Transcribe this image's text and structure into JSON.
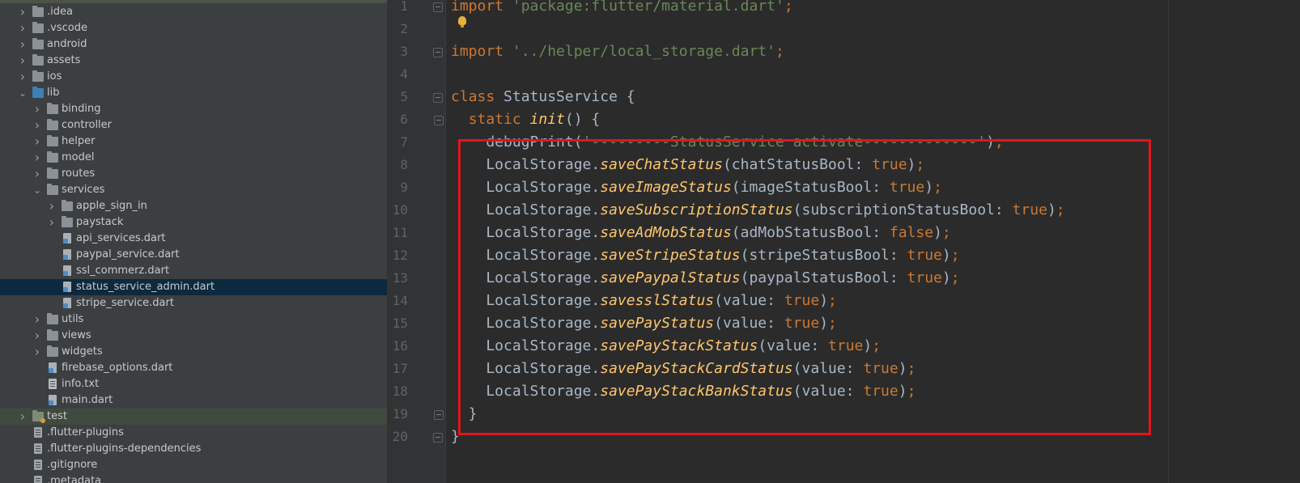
{
  "project_tree": {
    "items": [
      {
        "label": ".idea",
        "type": "folder",
        "expanded": false,
        "indent": 0
      },
      {
        "label": ".vscode",
        "type": "folder",
        "expanded": false,
        "indent": 0
      },
      {
        "label": "android",
        "type": "folder",
        "expanded": false,
        "indent": 0
      },
      {
        "label": "assets",
        "type": "folder",
        "expanded": false,
        "indent": 0
      },
      {
        "label": "ios",
        "type": "folder",
        "expanded": false,
        "indent": 0
      },
      {
        "label": "lib",
        "type": "folder",
        "expanded": true,
        "indent": 0
      },
      {
        "label": "binding",
        "type": "folder",
        "expanded": false,
        "indent": 1
      },
      {
        "label": "controller",
        "type": "folder",
        "expanded": false,
        "indent": 1
      },
      {
        "label": "helper",
        "type": "folder",
        "expanded": false,
        "indent": 1
      },
      {
        "label": "model",
        "type": "folder",
        "expanded": false,
        "indent": 1
      },
      {
        "label": "routes",
        "type": "folder",
        "expanded": false,
        "indent": 1
      },
      {
        "label": "services",
        "type": "folder",
        "expanded": true,
        "indent": 1
      },
      {
        "label": "apple_sign_in",
        "type": "folder",
        "expanded": false,
        "indent": 2
      },
      {
        "label": "paystack",
        "type": "folder",
        "expanded": false,
        "indent": 2
      },
      {
        "label": "api_services.dart",
        "type": "dart",
        "indent": 2
      },
      {
        "label": "paypal_service.dart",
        "type": "dart",
        "indent": 2
      },
      {
        "label": "ssl_commerz.dart",
        "type": "dart",
        "indent": 2
      },
      {
        "label": "status_service_admin.dart",
        "type": "dart",
        "indent": 2,
        "selected": true
      },
      {
        "label": "stripe_service.dart",
        "type": "dart",
        "indent": 2
      },
      {
        "label": "utils",
        "type": "folder",
        "expanded": false,
        "indent": 1
      },
      {
        "label": "views",
        "type": "folder",
        "expanded": false,
        "indent": 1
      },
      {
        "label": "widgets",
        "type": "folder",
        "expanded": false,
        "indent": 1
      },
      {
        "label": "firebase_options.dart",
        "type": "dart",
        "indent": 1
      },
      {
        "label": "info.txt",
        "type": "txt",
        "indent": 1
      },
      {
        "label": "main.dart",
        "type": "dart",
        "indent": 1
      },
      {
        "label": "test",
        "type": "folder",
        "expanded": false,
        "indent": 0,
        "test": true
      },
      {
        "label": ".flutter-plugins",
        "type": "cfg",
        "indent": 0
      },
      {
        "label": ".flutter-plugins-dependencies",
        "type": "cfg",
        "indent": 0
      },
      {
        "label": ".gitignore",
        "type": "cfg",
        "indent": 0
      },
      {
        "label": ".metadata",
        "type": "cfg",
        "indent": 0
      }
    ]
  },
  "editor": {
    "line_numbers": [
      "1",
      "2",
      "3",
      "4",
      "5",
      "6",
      "7",
      "8",
      "9",
      "10",
      "11",
      "12",
      "13",
      "14",
      "15",
      "16",
      "17",
      "18",
      "19",
      "20"
    ],
    "lines": [
      [
        [
          "kw",
          "import "
        ],
        [
          "str",
          "'package:flutter/material.dart'"
        ],
        [
          "kw",
          ";"
        ]
      ],
      [],
      [
        [
          "kw",
          "import "
        ],
        [
          "str",
          "'../helper/local_storage.dart'"
        ],
        [
          "kw",
          ";"
        ]
      ],
      [],
      [
        [
          "kw",
          "class "
        ],
        [
          "plain",
          "StatusService {"
        ]
      ],
      [
        [
          "plain",
          "  "
        ],
        [
          "kw",
          "static "
        ],
        [
          "fn",
          "init"
        ],
        [
          "plain",
          "() {"
        ]
      ],
      [
        [
          "plain",
          "    debugPrint("
        ],
        [
          "str",
          "'---------StatusService activate-------------'"
        ],
        [
          "plain",
          ")"
        ],
        [
          "kw",
          ";"
        ]
      ],
      [
        [
          "plain",
          "    LocalStorage."
        ],
        [
          "fn",
          "saveChatStatus"
        ],
        [
          "plain",
          "(chatStatusBool: "
        ],
        [
          "kw",
          "true"
        ],
        [
          "plain",
          ")"
        ],
        [
          "kw",
          ";"
        ]
      ],
      [
        [
          "plain",
          "    LocalStorage."
        ],
        [
          "fn",
          "saveImageStatus"
        ],
        [
          "plain",
          "(imageStatusBool: "
        ],
        [
          "kw",
          "true"
        ],
        [
          "plain",
          ")"
        ],
        [
          "kw",
          ";"
        ]
      ],
      [
        [
          "plain",
          "    LocalStorage."
        ],
        [
          "fn",
          "saveSubscriptionStatus"
        ],
        [
          "plain",
          "(subscriptionStatusBool: "
        ],
        [
          "kw",
          "true"
        ],
        [
          "plain",
          ")"
        ],
        [
          "kw",
          ";"
        ]
      ],
      [
        [
          "plain",
          "    LocalStorage."
        ],
        [
          "fn",
          "saveAdMobStatus"
        ],
        [
          "plain",
          "(adMobStatusBool: "
        ],
        [
          "kw",
          "false"
        ],
        [
          "plain",
          ")"
        ],
        [
          "kw",
          ";"
        ]
      ],
      [
        [
          "plain",
          "    LocalStorage."
        ],
        [
          "fn",
          "saveStripeStatus"
        ],
        [
          "plain",
          "(stripeStatusBool: "
        ],
        [
          "kw",
          "true"
        ],
        [
          "plain",
          ")"
        ],
        [
          "kw",
          ";"
        ]
      ],
      [
        [
          "plain",
          "    LocalStorage."
        ],
        [
          "fn",
          "savePaypalStatus"
        ],
        [
          "plain",
          "(paypalStatusBool: "
        ],
        [
          "kw",
          "true"
        ],
        [
          "plain",
          ")"
        ],
        [
          "kw",
          ";"
        ]
      ],
      [
        [
          "plain",
          "    LocalStorage."
        ],
        [
          "fn",
          "savesslStatus"
        ],
        [
          "plain",
          "(value: "
        ],
        [
          "kw",
          "true"
        ],
        [
          "plain",
          ")"
        ],
        [
          "kw",
          ";"
        ]
      ],
      [
        [
          "plain",
          "    LocalStorage."
        ],
        [
          "fn",
          "savePayStatus"
        ],
        [
          "plain",
          "(value: "
        ],
        [
          "kw",
          "true"
        ],
        [
          "plain",
          ")"
        ],
        [
          "kw",
          ";"
        ]
      ],
      [
        [
          "plain",
          "    LocalStorage."
        ],
        [
          "fn",
          "savePayStackStatus"
        ],
        [
          "plain",
          "(value: "
        ],
        [
          "kw",
          "true"
        ],
        [
          "plain",
          ")"
        ],
        [
          "kw",
          ";"
        ]
      ],
      [
        [
          "plain",
          "    LocalStorage."
        ],
        [
          "fn",
          "savePayStackCardStatus"
        ],
        [
          "plain",
          "(value: "
        ],
        [
          "kw",
          "true"
        ],
        [
          "plain",
          ")"
        ],
        [
          "kw",
          ";"
        ]
      ],
      [
        [
          "plain",
          "    LocalStorage."
        ],
        [
          "fn",
          "savePayStackBankStatus"
        ],
        [
          "plain",
          "(value: "
        ],
        [
          "kw",
          "true"
        ],
        [
          "plain",
          ")"
        ],
        [
          "kw",
          ";"
        ]
      ],
      [
        [
          "plain",
          "  }"
        ]
      ],
      [
        [
          "plain",
          "}"
        ]
      ]
    ]
  },
  "icons": {
    "chevron_collapsed": "chevron-right-icon",
    "chevron_expanded": "chevron-down-icon",
    "bulb": "intention-bulb-icon"
  },
  "colors": {
    "keyword": "#cc7832",
    "string": "#6a8759",
    "method": "#ffc66d",
    "text": "#a9b7c6",
    "highlight_box": "#e5141c"
  }
}
